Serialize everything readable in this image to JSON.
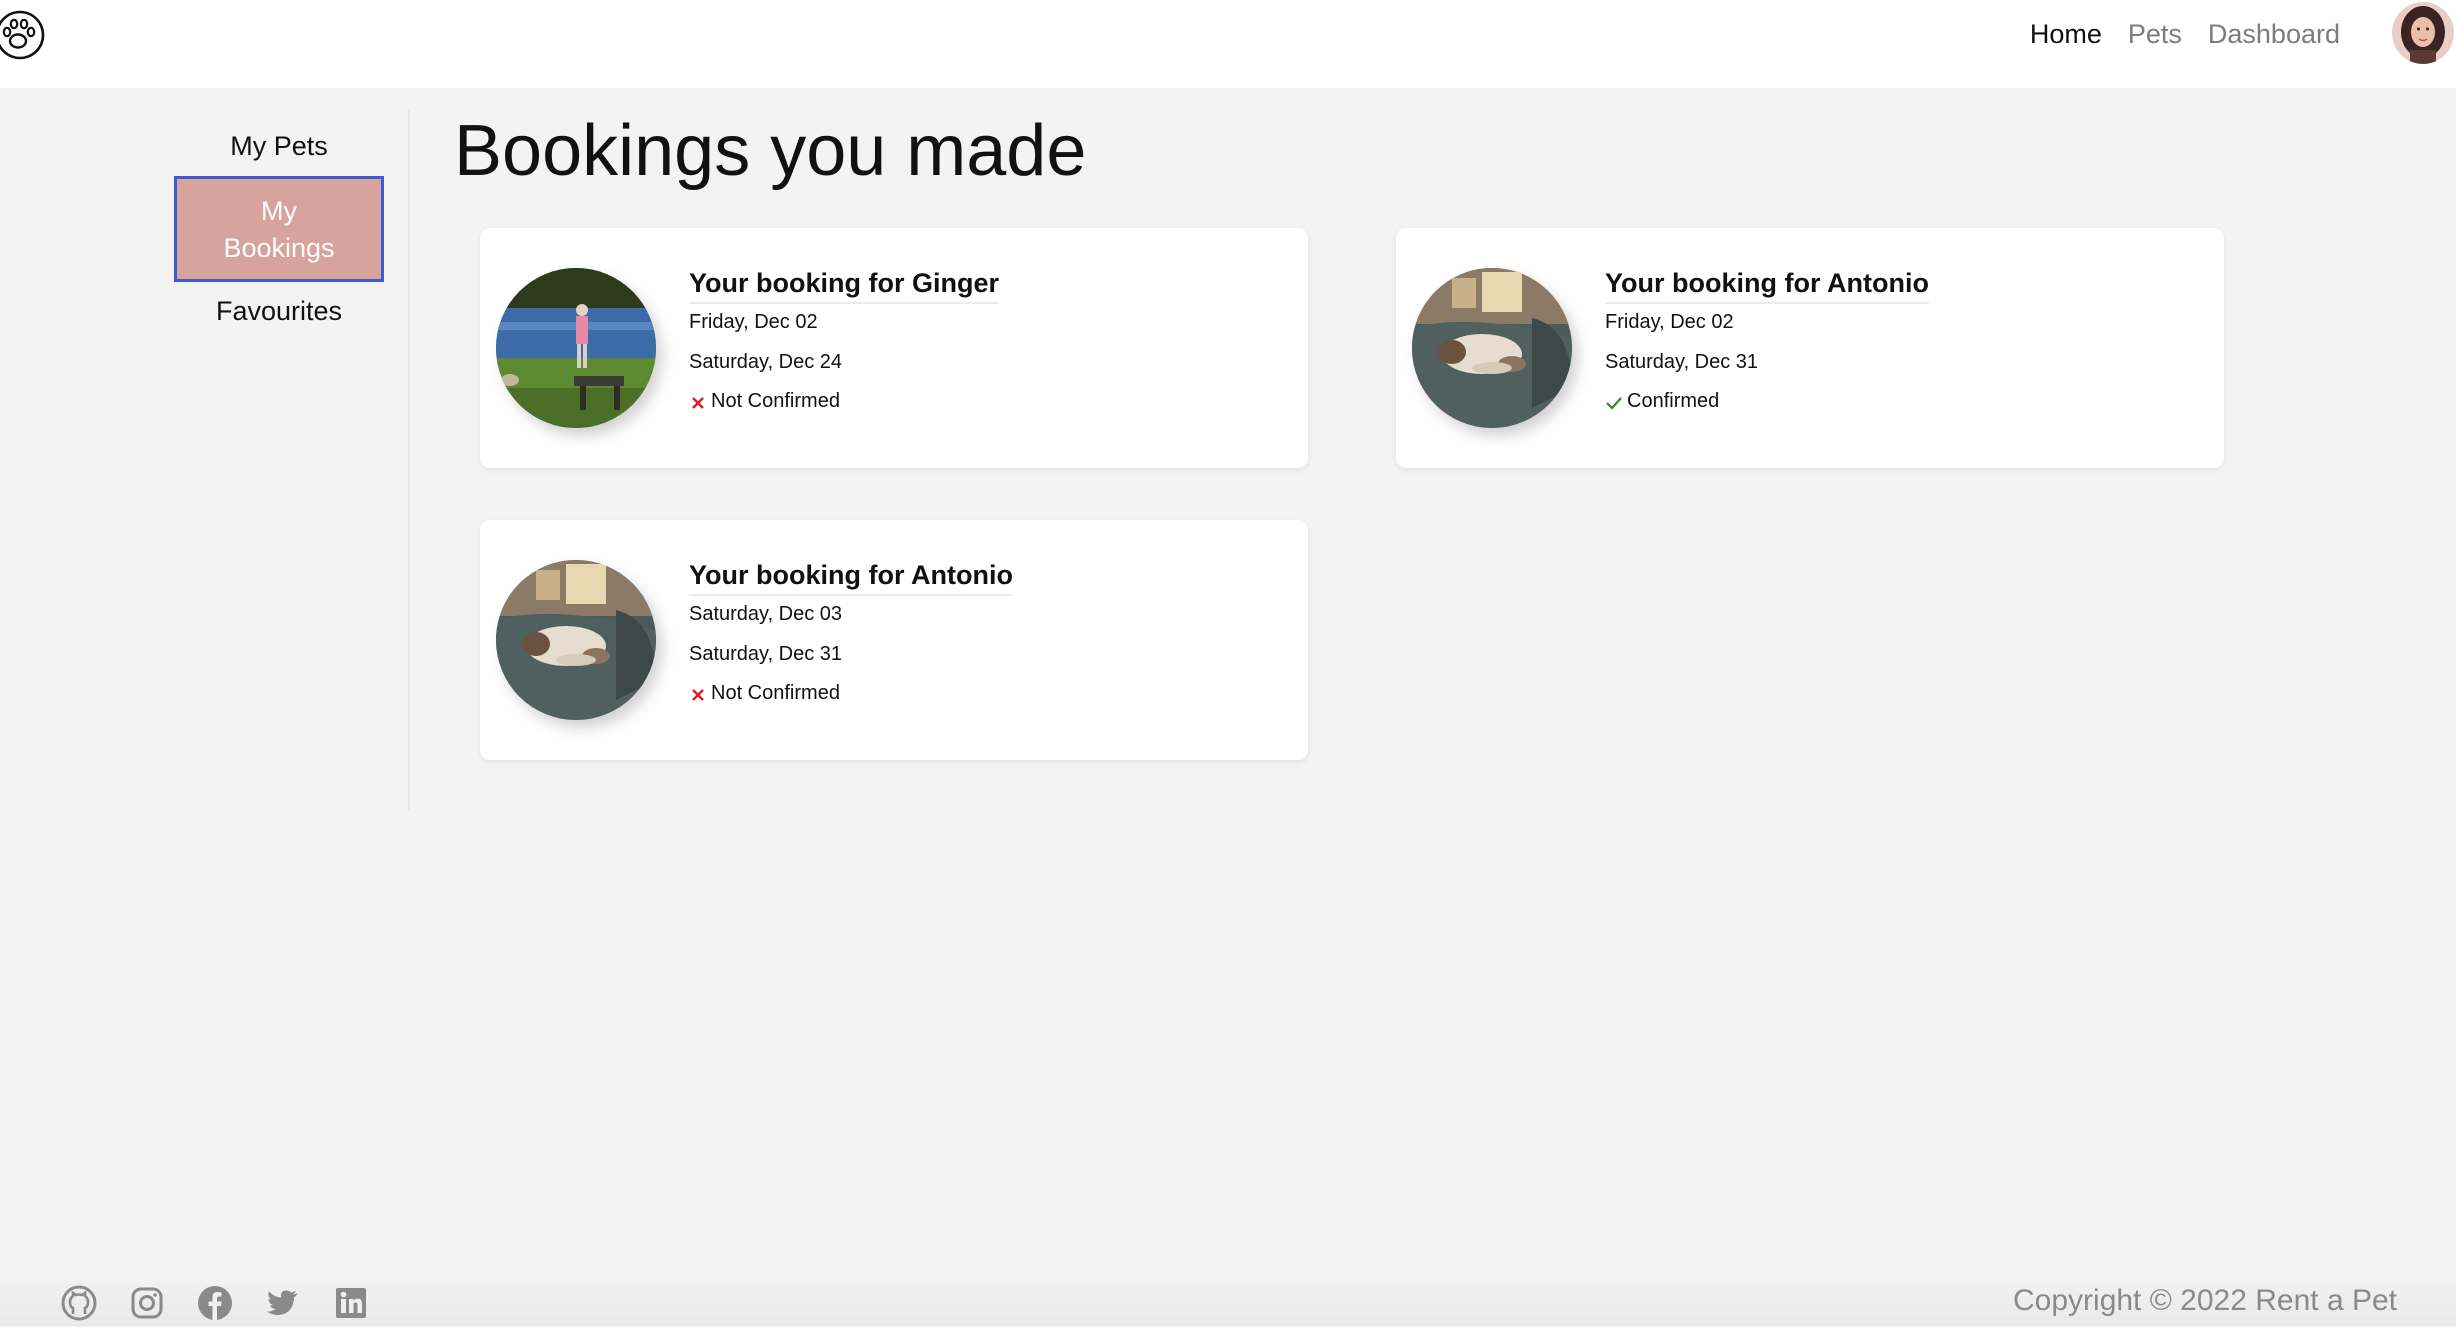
{
  "nav": {
    "links": [
      "Home",
      "Pets",
      "Dashboard"
    ],
    "active": "Home"
  },
  "sidebar": {
    "items": [
      {
        "label": "My Pets",
        "active": false
      },
      {
        "label": "My\nBookings",
        "active": true
      },
      {
        "label": "Favourites",
        "active": false
      }
    ]
  },
  "page": {
    "title": "Bookings you made"
  },
  "bookings": [
    {
      "title": "Your booking for Ginger",
      "start": "Friday, Dec 02",
      "end": "Saturday, Dec 24",
      "status": "Not Confirmed",
      "confirmed": false,
      "photo": "person-with-dog-by-lake"
    },
    {
      "title": "Your booking for Antonio",
      "start": "Friday, Dec 02",
      "end": "Saturday, Dec 31",
      "status": "Confirmed",
      "confirmed": true,
      "photo": "cat-sleeping-on-bed"
    },
    {
      "title": "Your booking for Antonio",
      "start": "Saturday, Dec 03",
      "end": "Saturday, Dec 31",
      "status": "Not Confirmed",
      "confirmed": false,
      "photo": "cat-sleeping-on-bed"
    }
  ],
  "footer": {
    "social_icons": [
      "github-icon",
      "instagram-icon",
      "facebook-icon",
      "twitter-icon",
      "linkedin-icon"
    ],
    "copyright": "Copyright © 2022 Rent a Pet"
  },
  "colors": {
    "sidebar_active_bg": "#d6a49d",
    "sidebar_active_border": "#3d5ad1",
    "not_confirmed": "#d42020",
    "confirmed": "#2e8b2e"
  }
}
